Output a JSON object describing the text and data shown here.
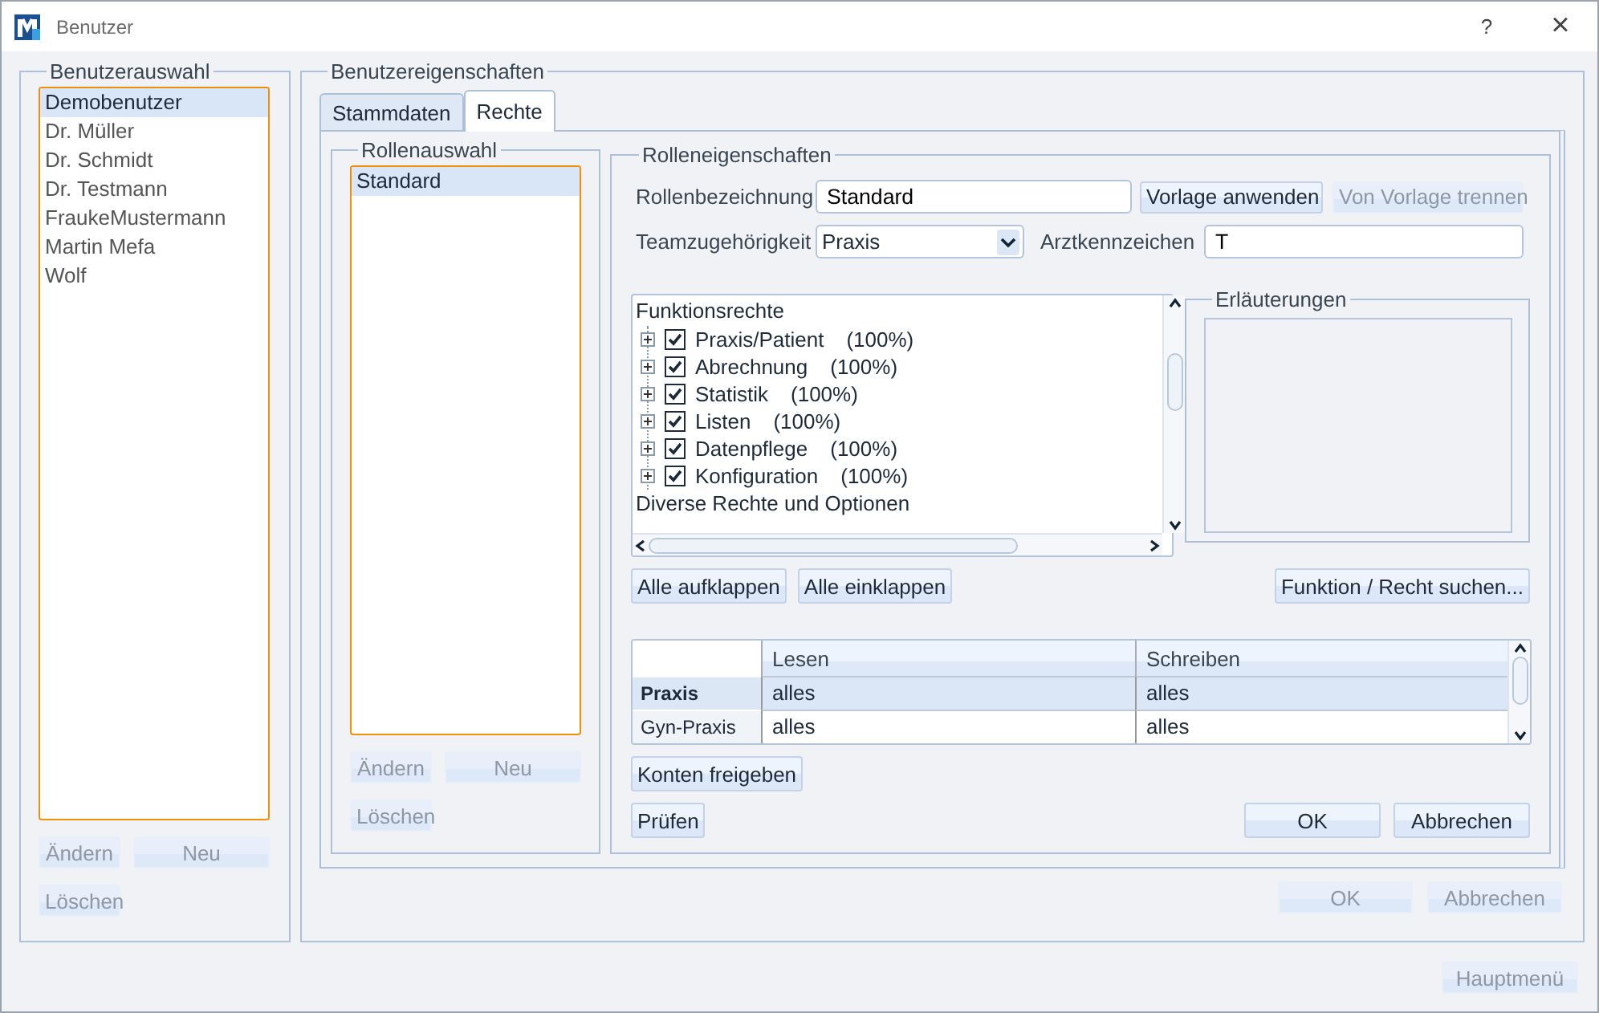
{
  "window": {
    "title": "Benutzer",
    "help": "?",
    "close": "×"
  },
  "user_selection": {
    "title": "Benutzerauswahl",
    "items": [
      {
        "label": "Demobenutzer",
        "selected": true
      },
      {
        "label": "Dr. Müller",
        "selected": false
      },
      {
        "label": "Dr. Schmidt",
        "selected": false
      },
      {
        "label": "Dr. Testmann",
        "selected": false
      },
      {
        "label": "FraukeMustermann",
        "selected": false
      },
      {
        "label": "Martin Mefa",
        "selected": false
      },
      {
        "label": "Wolf",
        "selected": false
      }
    ],
    "buttons": [
      {
        "label": "Ändern",
        "disabled": true
      },
      {
        "label": "Neu",
        "disabled": true
      },
      {
        "label": "Löschen",
        "disabled": true
      }
    ]
  },
  "user_properties": {
    "title": "Benutzereigenschaften",
    "tabs": [
      {
        "label": "Stammdaten",
        "selected": false
      },
      {
        "label": "Rechte",
        "selected": true
      }
    ],
    "role_selection": {
      "title": "Rollenauswahl",
      "items": [
        {
          "label": "Standard",
          "selected": true
        }
      ],
      "buttons": [
        {
          "label": "Ändern",
          "disabled": true
        },
        {
          "label": "Neu",
          "disabled": true
        },
        {
          "label": "Löschen",
          "disabled": true
        }
      ]
    },
    "role_properties": {
      "title": "Rolleneigenschaften",
      "role_name": {
        "label": "Rollenbezeichnung",
        "value": "Standard"
      },
      "template_buttons": [
        {
          "label": "Vorlage anwenden",
          "disabled": false
        },
        {
          "label": "Von Vorlage trennen",
          "disabled": true
        }
      ],
      "team": {
        "label": "Teamzugehörigkeit",
        "value": "Praxis"
      },
      "doctor_code": {
        "label": "Arztkennzeichen",
        "value": "T"
      },
      "tree": [
        {
          "label": "Funktionsrechte",
          "children": [
            {
              "label": "Praxis/Patient",
              "percent": "(100%)",
              "checked": true,
              "expanded": false
            },
            {
              "label": "Abrechnung",
              "percent": "(100%)",
              "checked": true,
              "expanded": false
            },
            {
              "label": "Statistik",
              "percent": "(100%)",
              "checked": true,
              "expanded": false
            },
            {
              "label": "Listen",
              "percent": "(100%)",
              "checked": true,
              "expanded": false
            },
            {
              "label": "Datenpflege",
              "percent": "(100%)",
              "checked": true,
              "expanded": false
            },
            {
              "label": "Konfiguration",
              "percent": "(100%)",
              "checked": true,
              "expanded": false
            }
          ]
        },
        {
          "label": "Diverse Rechte und Optionen"
        }
      ],
      "explanations": {
        "title": "Erläuterungen"
      },
      "tree_buttons": [
        {
          "label": "Alle aufklappen",
          "disabled": false
        },
        {
          "label": "Alle einklappen",
          "disabled": false
        }
      ],
      "search_button": {
        "label": "Funktion / Recht suchen...",
        "disabled": false
      },
      "grid": {
        "columns": [
          "Lesen",
          "Schreiben"
        ],
        "rows": [
          {
            "header": "Praxis",
            "selected": true,
            "cells": [
              "alles",
              "alles"
            ]
          },
          {
            "header": "Gyn-Praxis",
            "selected": false,
            "cells": [
              "alles",
              "alles"
            ]
          }
        ]
      },
      "release_button": {
        "label": "Konten freigeben",
        "disabled": false
      },
      "check_button": {
        "label": "Prüfen",
        "disabled": false
      },
      "dialog_buttons": [
        {
          "label": "OK",
          "disabled": false
        },
        {
          "label": "Abbrechen",
          "disabled": false
        }
      ]
    },
    "buttons": [
      {
        "label": "OK",
        "disabled": true
      },
      {
        "label": "Abbrechen",
        "disabled": true
      }
    ]
  },
  "main_menu_button": {
    "label": "Hauptmenü",
    "disabled": true
  }
}
